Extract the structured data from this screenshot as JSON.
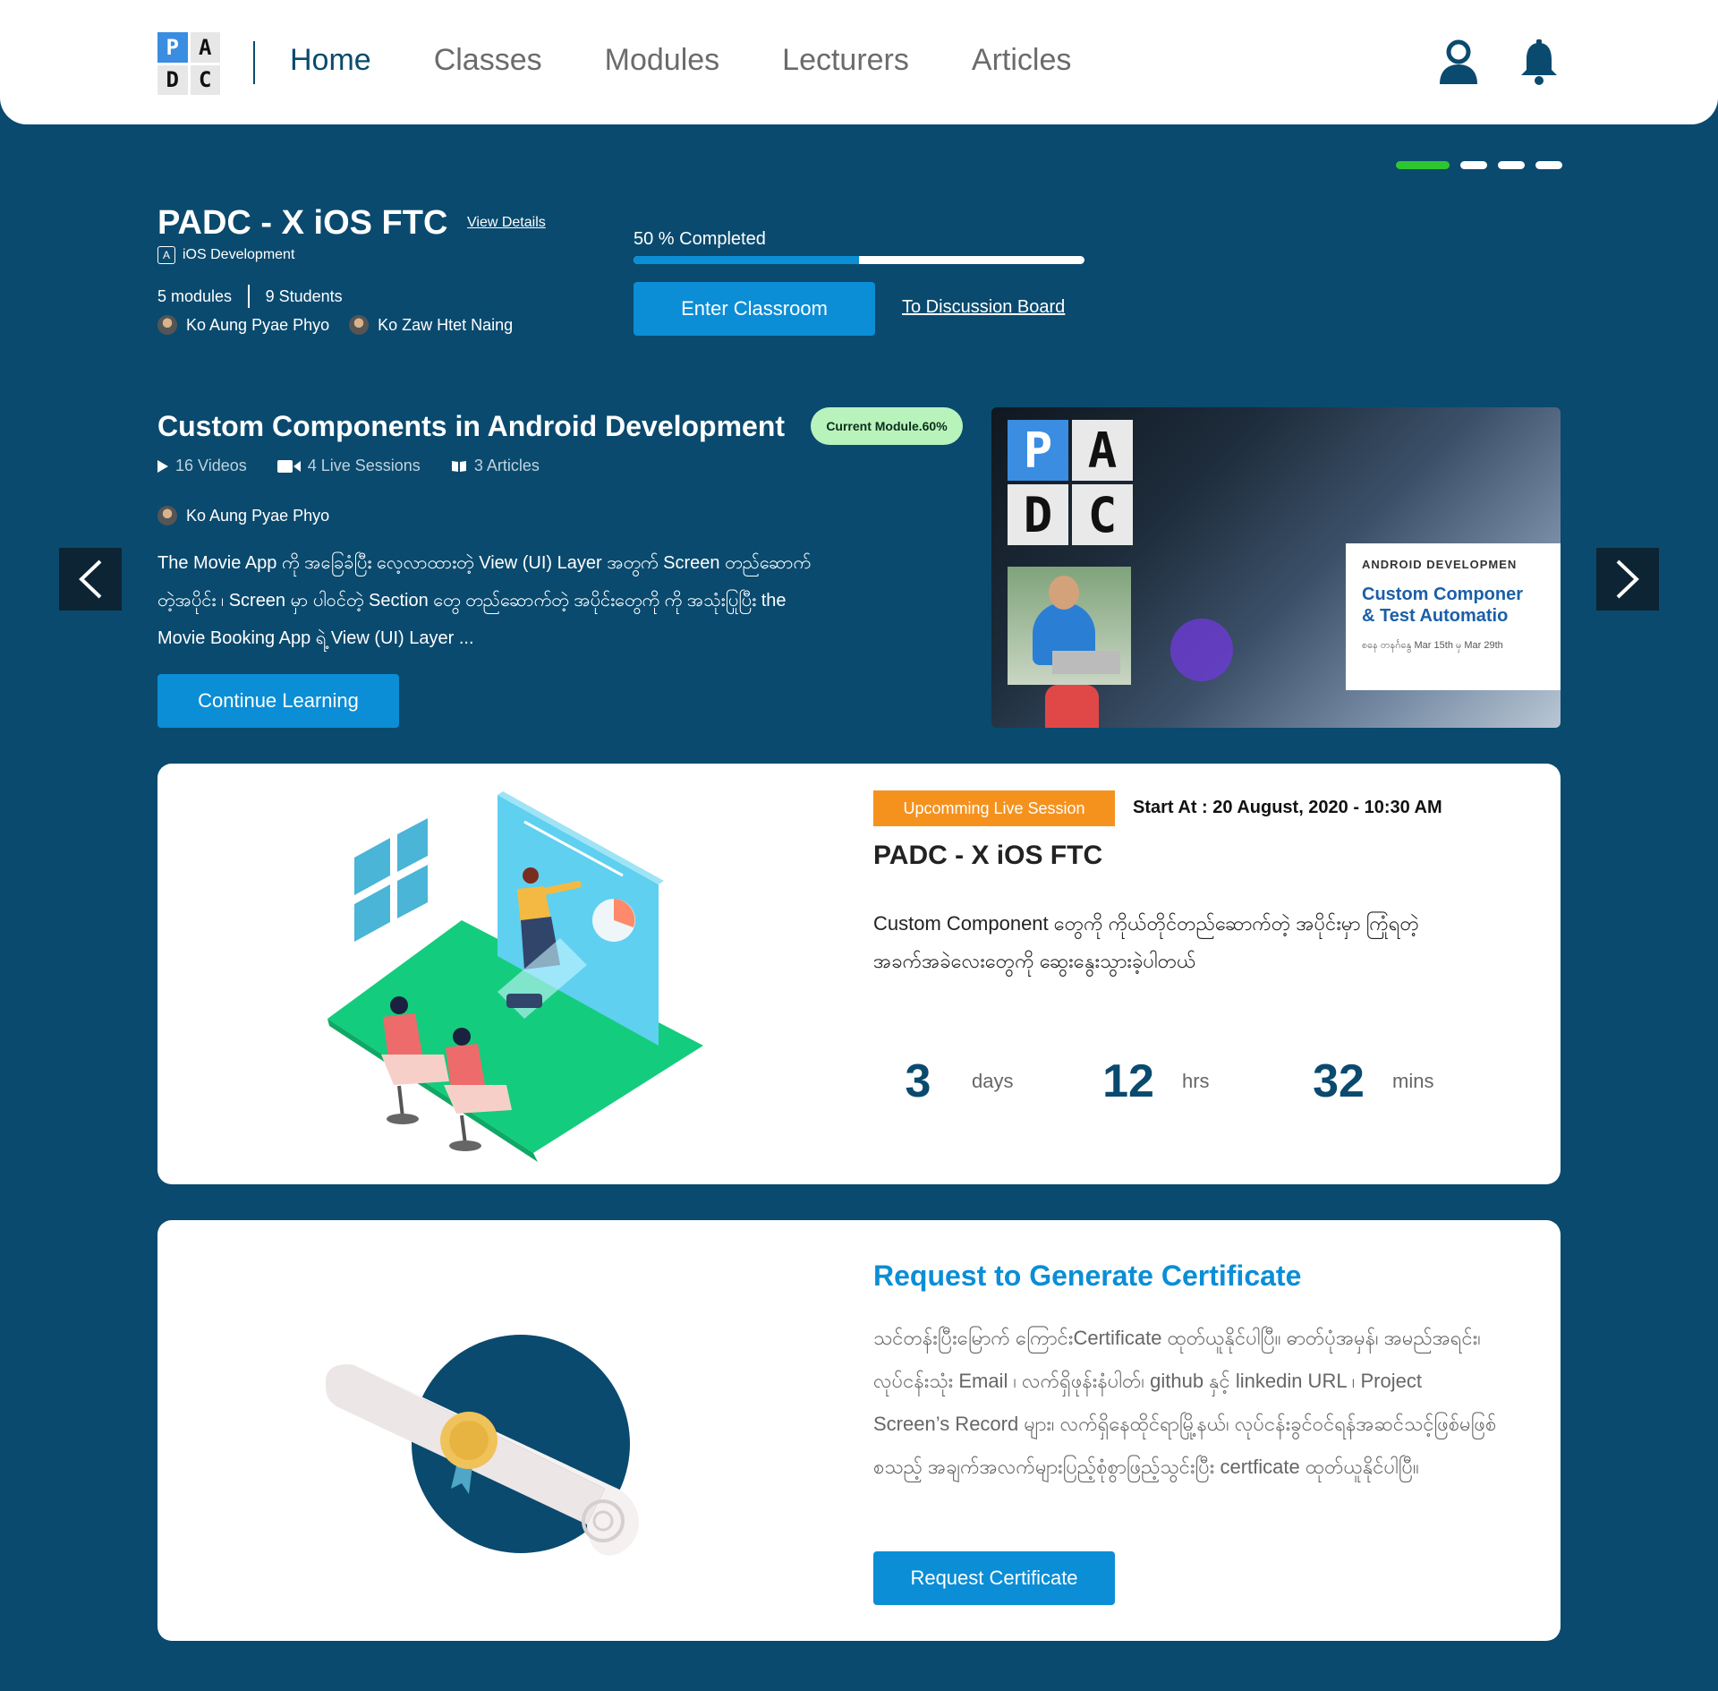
{
  "header": {
    "logo_letters": [
      "P",
      "A",
      "D",
      "C"
    ],
    "nav": [
      "Home",
      "Classes",
      "Modules",
      "Lecturers",
      "Articles"
    ],
    "active_nav": "Home"
  },
  "slider": {
    "count": 4,
    "active_index": 0
  },
  "current_class": {
    "title": "PADC - X iOS FTC",
    "view_details": "View Details",
    "category": "iOS Development",
    "modules": "5 modules",
    "students": "9 Students",
    "lecturers": [
      "Ko Aung Pyae Phyo",
      "Ko Zaw Htet Naing"
    ],
    "progress_label": "50 % Completed",
    "progress_percent": 50,
    "enter_button": "Enter Classroom",
    "discussion_link": "To Discussion Board"
  },
  "current_module": {
    "title": "Custom Components in Android Development",
    "badge": "Current Module.60%",
    "videos": "16 Videos",
    "live_sessions": "4 Live Sessions",
    "articles": "3 Articles",
    "lecturer": "Ko Aung Pyae Phyo",
    "description": "The Movie App ကို အခြေခံပြီး လေ့လာထားတဲ့ View (UI) Layer အတွက် Screen တည်ဆောက်တဲ့အပိုင်း ၊ Screen မှာ ပါဝင်တဲ့ Section တွေ တည်ဆောက်တဲ့ အပိုင်းတွေကို ကို အသုံးပြုပြီး the Movie Booking App ရဲ့ View (UI) Layer ...",
    "continue_button": "Continue Learning",
    "image": {
      "logo_letters": [
        "P",
        "A",
        "D",
        "C"
      ],
      "card_heading": "ANDROID DEVELOPMEN",
      "card_title_1": "Custom Componer",
      "card_title_2": "& Test Automatio",
      "card_dates": "စနေ တနင်္ဂနွေ Mar 15th မှ Mar 29th"
    }
  },
  "live_session": {
    "badge": "Upcomming Live Session",
    "start_at": "Start At : 20 August, 2020 - 10:30 AM",
    "title": "PADC - X iOS FTC",
    "description": "Custom Component တွေကို ကိုယ်တိုင်တည်ဆောက်တဲ့ အပိုင်းမှာ ကြုံရတဲ့ အခက်အခဲလေးတွေကို ဆွေးနွေးသွားခဲ့ပါတယ်",
    "countdown": [
      {
        "value": "3",
        "unit": "days"
      },
      {
        "value": "12",
        "unit": "hrs"
      },
      {
        "value": "32",
        "unit": "mins"
      }
    ]
  },
  "certificate": {
    "title": "Request to Generate Certificate",
    "description": "သင်တန်းပြီးမြောက် ကြောင်းCertificate ထုတ်ယူနိုင်ပါပြီ။ ဓာတ်ပုံအမှန်၊ အမည်အရင်း၊ လုပ်ငန်းသုံး Email ၊ လက်ရှိဖုန်းနံပါတ်၊ github နှင့် linkedin URL ၊ Project Screen’s Record များ၊ လက်ရှိနေထိုင်ရာမြို့နယ်၊ လုပ်ငန်းခွင်ဝင်ရန်အဆင်သင့်ဖြစ်မဖြစ် စသည့် အချက်အလက်များပြည့်စုံစွာဖြည့်သွင်းပြီး certficate ထုတ်ယူနိုင်ပါပြီ။",
    "button": "Request Certificate"
  },
  "colors": {
    "background": "#0a4a6e",
    "primary_button": "#0b8ed6",
    "active_dot": "#2ec630",
    "module_badge": "#b9f3bc",
    "live_badge": "#f5921e",
    "illustration_green": "#14cc7d"
  }
}
